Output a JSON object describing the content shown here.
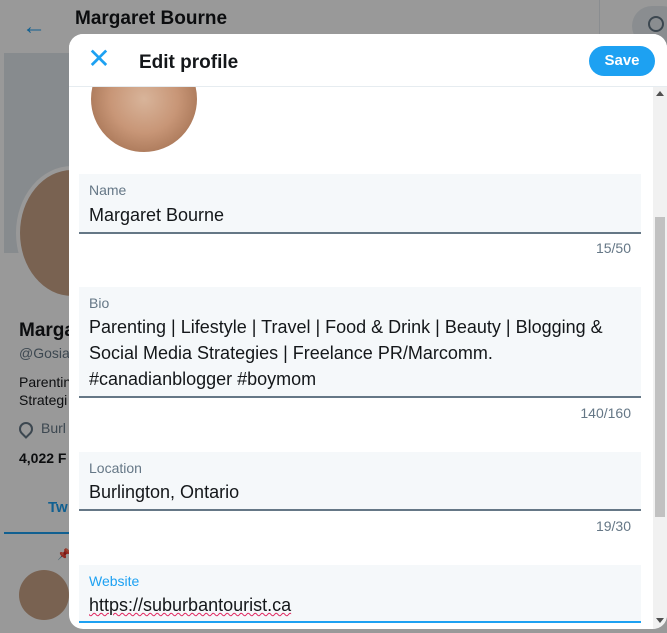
{
  "background": {
    "header_title": "Margaret Bourne",
    "profile_name": "Marga",
    "handle": "@Gosia",
    "bio_fragment": "Parentin Strategi",
    "location_fragment": "Burl",
    "followers": "4,022 F",
    "tab": "Tw"
  },
  "modal": {
    "title": "Edit profile",
    "save_label": "Save",
    "close_glyph": "✕",
    "fields": {
      "name": {
        "label": "Name",
        "value": "Margaret Bourne",
        "counter": "15/50"
      },
      "bio": {
        "label": "Bio",
        "value": "Parenting | Lifestyle | Travel | Food & Drink | Beauty | Blogging & Social Media Strategies | Freelance PR/Marcomm. #canadianblogger #boymom",
        "counter": "140/160"
      },
      "location": {
        "label": "Location",
        "value": "Burlington, Ontario",
        "counter": "19/30"
      },
      "website": {
        "label": "Website",
        "value": "https://suburbantourist.ca"
      }
    }
  },
  "colors": {
    "accent": "#1da1f2",
    "muted": "#657786",
    "field_bg": "#f5f8fa"
  },
  "icons": {
    "back": "arrow-left-icon",
    "close": "close-icon",
    "camera": "camera-icon",
    "search": "search-icon",
    "location": "location-pin-icon"
  }
}
